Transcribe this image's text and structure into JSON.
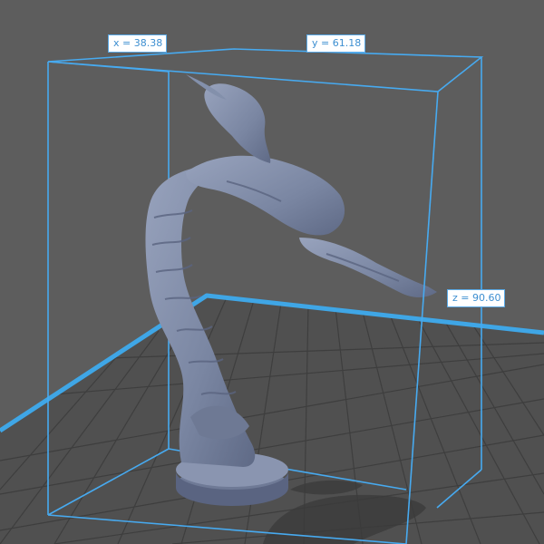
{
  "viewport": {
    "background": "#5d5d5d",
    "plate_color": "#4f4f4f",
    "plate_line_color": "#3f3f3f",
    "plate_edge_color": "#3fa6e6",
    "bounding_box_color": "#47aaf0",
    "model_color": "#7e8aa6"
  },
  "dimensions": {
    "x_label": "x = 38.38",
    "y_label": "y = 61.18",
    "z_label": "z = 90.60"
  }
}
